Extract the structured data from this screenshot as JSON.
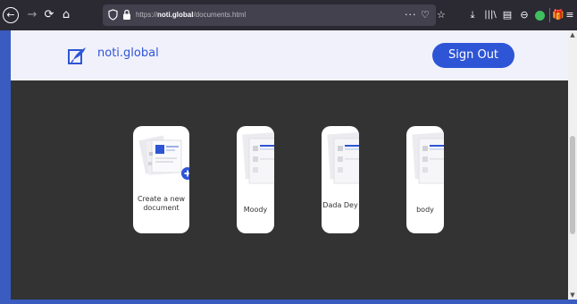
{
  "browser": {
    "url_prefix": "https://",
    "url_domain": "noti.global",
    "url_path": "/documents.html",
    "icons": {
      "back": "←",
      "forward": "→",
      "reload": "⟳",
      "home": "⌂",
      "more": "···",
      "pocket": "♡",
      "bookmark": "☆",
      "download": "⤓",
      "library": "|||\\",
      "sidebar": "▤",
      "account": "⊖",
      "gift": "🎁",
      "menu": "≡"
    }
  },
  "header": {
    "brand": "noti.global",
    "sign_out_label": "Sign Out",
    "brand_color": "#2e55d6"
  },
  "documents": {
    "create_label": "Create a new document",
    "items": [
      {
        "title": "Moody"
      },
      {
        "title": "Dada Dey"
      },
      {
        "title": "body"
      }
    ]
  },
  "scrollbar": {
    "up": "▲",
    "down": "▼"
  }
}
